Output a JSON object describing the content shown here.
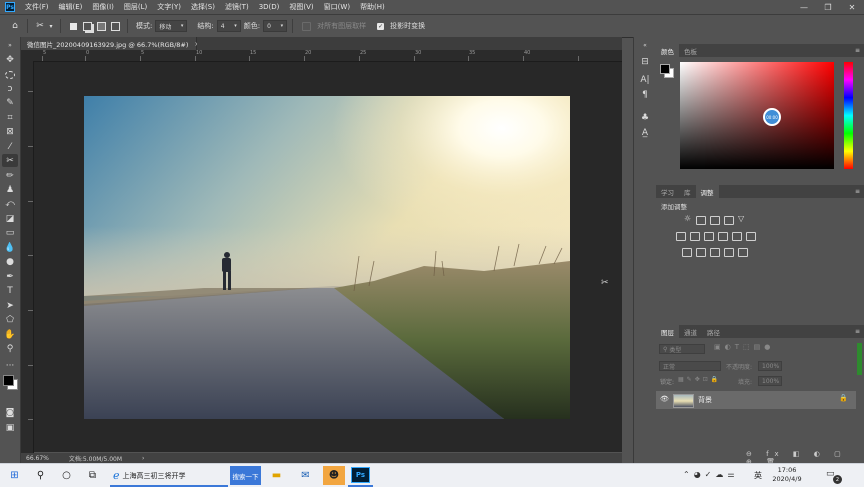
{
  "app": {
    "logo": "Ps",
    "menus": [
      "文件(F)",
      "编辑(E)",
      "图像(I)",
      "图层(L)",
      "文字(Y)",
      "选择(S)",
      "滤镜(T)",
      "3D(D)",
      "视图(V)",
      "窗口(W)",
      "帮助(H)"
    ],
    "window_controls": [
      "—",
      "❐",
      "✕"
    ]
  },
  "options_bar": {
    "mode_label": "模式:",
    "mode_value": "移动",
    "structure_label": "结构:",
    "structure_value": "4",
    "color_label": "颜色:",
    "color_value": "0",
    "sample_all_layers": "对所有图层取样",
    "transform_on_drop": "投影时变换"
  },
  "document": {
    "tab_title": "微信图片_20200409163929.jpg @ 66.7%(RGB/8#)",
    "tab_close": "×",
    "zoom": "66.67%",
    "doc_info": "文档:5.00M/5.00M",
    "status_arrow": "›"
  },
  "rulers": {
    "top": [
      "5",
      "0",
      "5",
      "10",
      "15",
      "20",
      "25",
      "30",
      "35",
      "40"
    ]
  },
  "color_panel": {
    "tabs": [
      "颜色",
      "色板"
    ],
    "hex_preview": "#ffffff",
    "picker_hue": "#ff0000"
  },
  "adjust_panel": {
    "tabs": [
      "学习",
      "库",
      "调整"
    ],
    "title": "添加调整"
  },
  "layers_panel": {
    "tabs": [
      "图层",
      "通道",
      "路径"
    ],
    "filter_placeholder": "类型",
    "blend_mode": "正常",
    "opacity_label": "不透明度:",
    "opacity_value": "100%",
    "lock_label": "锁定:",
    "fill_label": "填充:",
    "fill_value": "100%",
    "layer_name": "背景"
  },
  "taskbar": {
    "ie_label": "上海高三初三将开学",
    "search_btn": "搜索一下",
    "ps_label": "Ps",
    "ime": "英",
    "time": "17:06",
    "date": "2020/4/9",
    "notification_badge": "2"
  },
  "colors": {
    "accent": "#31a8ff",
    "panel_bg": "#535353",
    "canvas_bg": "#282828"
  }
}
